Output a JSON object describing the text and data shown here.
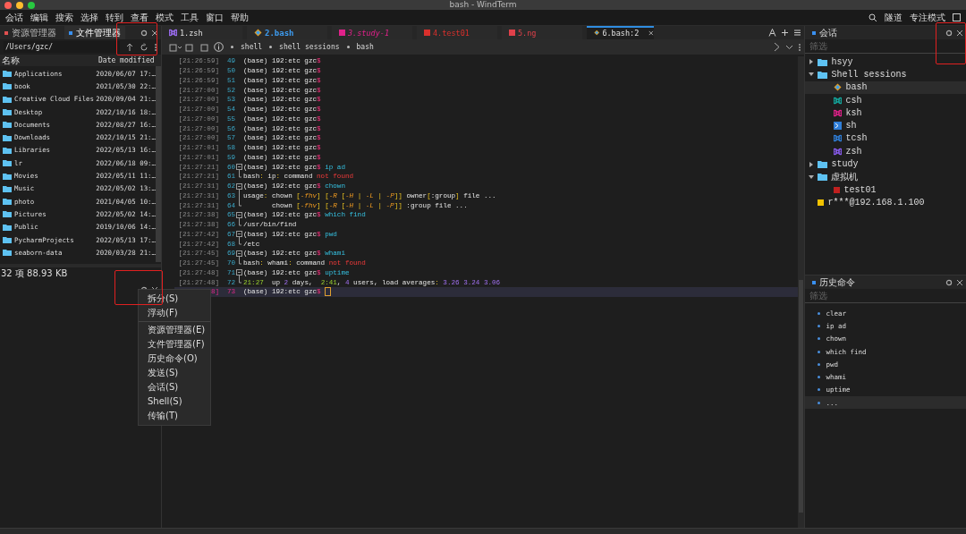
{
  "window": {
    "title": "bash - WindTerm"
  },
  "menu_bar": {
    "items": [
      "会话",
      "编辑",
      "搜索",
      "选择",
      "转到",
      "查看",
      "模式",
      "工具",
      "窗口",
      "帮助"
    ],
    "right": [
      "隧道",
      "专注模式"
    ]
  },
  "left_panel": {
    "tabs": [
      {
        "label": "资源管理器",
        "selected": false
      },
      {
        "label": "文件管理器",
        "selected": true
      }
    ],
    "path": "/Users/gzc/",
    "columns": [
      "名称",
      "Date modified"
    ],
    "files": [
      {
        "name": "Applications",
        "date": "2020/06/07 17:…"
      },
      {
        "name": "book",
        "date": "2021/05/30 22:…"
      },
      {
        "name": "Creative Cloud Files",
        "date": "2020/09/04 21:…"
      },
      {
        "name": "Desktop",
        "date": "2022/10/16 18:…"
      },
      {
        "name": "Documents",
        "date": "2022/08/27 16:…"
      },
      {
        "name": "Downloads",
        "date": "2022/10/15 21:…"
      },
      {
        "name": "Libraries",
        "date": "2022/05/13 16:…"
      },
      {
        "name": "lr",
        "date": "2022/06/18 09:…"
      },
      {
        "name": "Movies",
        "date": "2022/05/11 11:…"
      },
      {
        "name": "Music",
        "date": "2022/05/02 13:…"
      },
      {
        "name": "photo",
        "date": "2021/04/05 10:…"
      },
      {
        "name": "Pictures",
        "date": "2022/05/02 14:…"
      },
      {
        "name": "Public",
        "date": "2019/10/06 14:…"
      },
      {
        "name": "PycharmProjects",
        "date": "2022/05/13 17:…"
      },
      {
        "name": "seaborn-data",
        "date": "2020/03/28 21:…"
      }
    ],
    "status": "32 项 88.93 KB"
  },
  "context_menu": {
    "groups": [
      [
        "拆分(S)",
        "浮动(F)"
      ],
      [
        "资源管理器(E)",
        "文件管理器(F)",
        "历史命令(O)",
        "发送(S)",
        "会话(S)",
        "Shell(S)",
        "传输(T)"
      ]
    ]
  },
  "terminal_tabs": [
    {
      "label": "1.zsh",
      "kind": "shell",
      "color": "#9b6cf0",
      "selected": false
    },
    {
      "label": "2.bash",
      "kind": "bash",
      "color": "#3d9cf0",
      "selected": false
    },
    {
      "label": "3.study-1",
      "kind": "session",
      "color": "#e0218a",
      "selected": false
    },
    {
      "label": "4.test01",
      "kind": "session",
      "color": "#d9302c",
      "selected": false
    },
    {
      "label": "5.ng",
      "kind": "session",
      "color": "#e0404a",
      "selected": false
    },
    {
      "label": "6.bash:2",
      "kind": "bash",
      "selected": true
    }
  ],
  "breadcrumb": [
    "shell",
    "shell sessions",
    "bash"
  ],
  "terminal_lines": [
    {
      "time": "[21:26:59]",
      "num": "49",
      "kind": "plain",
      "segs": [
        {
          "kind": "text",
          "t": "(base) 192:etc gzc"
        },
        {
          "kind": "sign",
          "t": "$"
        }
      ]
    },
    {
      "time": "[21:26:59]",
      "num": "50",
      "kind": "plain",
      "segs": [
        {
          "kind": "text",
          "t": "(base) 192:etc gzc"
        },
        {
          "kind": "sign",
          "t": "$"
        }
      ]
    },
    {
      "time": "[21:26:59]",
      "num": "51",
      "kind": "plain",
      "segs": [
        {
          "kind": "text",
          "t": "(base) 192:etc gzc"
        },
        {
          "kind": "sign",
          "t": "$"
        }
      ]
    },
    {
      "time": "[21:27:00]",
      "num": "52",
      "kind": "plain",
      "segs": [
        {
          "kind": "text",
          "t": "(base) 192:etc gzc"
        },
        {
          "kind": "sign",
          "t": "$"
        }
      ]
    },
    {
      "time": "[21:27:00]",
      "num": "53",
      "kind": "plain",
      "segs": [
        {
          "kind": "text",
          "t": "(base) 192:etc gzc"
        },
        {
          "kind": "sign",
          "t": "$"
        }
      ]
    },
    {
      "time": "[21:27:00]",
      "num": "54",
      "kind": "plain",
      "segs": [
        {
          "kind": "text",
          "t": "(base) 192:etc gzc"
        },
        {
          "kind": "sign",
          "t": "$"
        }
      ]
    },
    {
      "time": "[21:27:00]",
      "num": "55",
      "kind": "plain",
      "segs": [
        {
          "kind": "text",
          "t": "(base) 192:etc gzc"
        },
        {
          "kind": "sign",
          "t": "$"
        }
      ]
    },
    {
      "time": "[21:27:00]",
      "num": "56",
      "kind": "plain",
      "segs": [
        {
          "kind": "text",
          "t": "(base) 192:etc gzc"
        },
        {
          "kind": "sign",
          "t": "$"
        }
      ]
    },
    {
      "time": "[21:27:00]",
      "num": "57",
      "kind": "plain",
      "segs": [
        {
          "kind": "text",
          "t": "(base) 192:etc gzc"
        },
        {
          "kind": "sign",
          "t": "$"
        }
      ]
    },
    {
      "time": "[21:27:01]",
      "num": "58",
      "kind": "plain",
      "segs": [
        {
          "kind": "text",
          "t": "(base) 192:etc gzc"
        },
        {
          "kind": "sign",
          "t": "$"
        }
      ]
    },
    {
      "time": "[21:27:01]",
      "num": "59",
      "kind": "plain",
      "segs": [
        {
          "kind": "text",
          "t": "(base) 192:etc gzc"
        },
        {
          "kind": "sign",
          "t": "$"
        }
      ]
    },
    {
      "time": "[21:27:21]",
      "num": "60",
      "kind": "fold_start",
      "segs": [
        {
          "kind": "text",
          "t": "(base) 192:etc gzc"
        },
        {
          "kind": "sign",
          "t": "$"
        },
        {
          "kind": "command",
          "t": " ip ad"
        }
      ]
    },
    {
      "time": "[21:27:21]",
      "num": "61",
      "kind": "fold_end",
      "segs": [
        {
          "kind": "text",
          "t": "bash"
        },
        {
          "kind": "punct",
          "t": ":"
        },
        {
          "kind": "text",
          "t": " ip"
        },
        {
          "kind": "punct",
          "t": ":"
        },
        {
          "kind": "text",
          "t": " command "
        },
        {
          "kind": "error",
          "t": "not found"
        }
      ]
    },
    {
      "time": "[21:27:31]",
      "num": "62",
      "kind": "fold_start",
      "segs": [
        {
          "kind": "text",
          "t": "(base) 192:etc gzc"
        },
        {
          "kind": "sign",
          "t": "$"
        },
        {
          "kind": "command",
          "t": " chown"
        }
      ]
    },
    {
      "time": "[21:27:31]",
      "num": "63",
      "kind": "fold_middle",
      "segs": [
        {
          "kind": "text",
          "t": "usage"
        },
        {
          "kind": "punct",
          "t": ":"
        },
        {
          "kind": "text",
          "t": " chown "
        },
        {
          "kind": "punct",
          "t": "["
        },
        {
          "kind": "option",
          "t": "-fhv"
        },
        {
          "kind": "punct",
          "t": "] ["
        },
        {
          "kind": "option",
          "t": "-R"
        },
        {
          "kind": "punct",
          "t": " ["
        },
        {
          "kind": "option",
          "t": "-H"
        },
        {
          "kind": "punct",
          "t": " | "
        },
        {
          "kind": "option",
          "t": "-L"
        },
        {
          "kind": "punct",
          "t": " | "
        },
        {
          "kind": "option",
          "t": "-P"
        },
        {
          "kind": "punct",
          "t": "]]"
        },
        {
          "kind": "text",
          "t": " owner"
        },
        {
          "kind": "punct",
          "t": "["
        },
        {
          "kind": "text",
          "t": ":group"
        },
        {
          "kind": "punct",
          "t": "]"
        },
        {
          "kind": "text",
          "t": " file ..."
        }
      ]
    },
    {
      "time": "[21:27:31]",
      "num": "64",
      "kind": "fold_end",
      "segs": [
        {
          "kind": "text",
          "t": "       chown "
        },
        {
          "kind": "punct",
          "t": "["
        },
        {
          "kind": "option",
          "t": "-fhv"
        },
        {
          "kind": "punct",
          "t": "] ["
        },
        {
          "kind": "option",
          "t": "-R"
        },
        {
          "kind": "punct",
          "t": " ["
        },
        {
          "kind": "option",
          "t": "-H"
        },
        {
          "kind": "punct",
          "t": " | "
        },
        {
          "kind": "option",
          "t": "-L"
        },
        {
          "kind": "punct",
          "t": " | "
        },
        {
          "kind": "option",
          "t": "-P"
        },
        {
          "kind": "punct",
          "t": "]]"
        },
        {
          "kind": "text",
          "t": " :group file ..."
        }
      ]
    },
    {
      "time": "[21:27:38]",
      "num": "65",
      "kind": "fold_start",
      "segs": [
        {
          "kind": "text",
          "t": "(base) 192:etc gzc"
        },
        {
          "kind": "sign",
          "t": "$"
        },
        {
          "kind": "command",
          "t": " which find"
        }
      ]
    },
    {
      "time": "[21:27:38]",
      "num": "66",
      "kind": "fold_end",
      "segs": [
        {
          "kind": "text",
          "t": "/usr/bin/find"
        }
      ]
    },
    {
      "time": "[21:27:42]",
      "num": "67",
      "kind": "fold_start",
      "segs": [
        {
          "kind": "text",
          "t": "(base) 192:etc gzc"
        },
        {
          "kind": "sign",
          "t": "$"
        },
        {
          "kind": "command",
          "t": " pwd"
        }
      ]
    },
    {
      "time": "[21:27:42]",
      "num": "68",
      "kind": "fold_end",
      "segs": [
        {
          "kind": "text",
          "t": "/etc"
        }
      ]
    },
    {
      "time": "[21:27:45]",
      "num": "69",
      "kind": "fold_start",
      "segs": [
        {
          "kind": "text",
          "t": "(base) 192:etc gzc"
        },
        {
          "kind": "sign",
          "t": "$"
        },
        {
          "kind": "command",
          "t": " whami"
        }
      ]
    },
    {
      "time": "[21:27:45]",
      "num": "70",
      "kind": "fold_end",
      "segs": [
        {
          "kind": "text",
          "t": "bash"
        },
        {
          "kind": "punct",
          "t": ":"
        },
        {
          "kind": "text",
          "t": " whami"
        },
        {
          "kind": "punct",
          "t": ":"
        },
        {
          "kind": "text",
          "t": " command "
        },
        {
          "kind": "error",
          "t": "not found"
        }
      ]
    },
    {
      "time": "[21:27:48]",
      "num": "71",
      "kind": "fold_start",
      "segs": [
        {
          "kind": "text",
          "t": "(base) 192:etc gzc"
        },
        {
          "kind": "sign",
          "t": "$"
        },
        {
          "kind": "command",
          "t": " uptime"
        }
      ]
    },
    {
      "time": "[21:27:48]",
      "num": "72",
      "kind": "fold_end",
      "segs": [
        {
          "kind": "time",
          "t": "21:27"
        },
        {
          "kind": "text",
          "t": "  up "
        },
        {
          "kind": "number",
          "t": "2"
        },
        {
          "kind": "text",
          "t": " days,  "
        },
        {
          "kind": "time",
          "t": "2:41"
        },
        {
          "kind": "text",
          "t": ", "
        },
        {
          "kind": "number",
          "t": "4"
        },
        {
          "kind": "text",
          "t": " users, load averages"
        },
        {
          "kind": "punct",
          "t": ":"
        },
        {
          "kind": "number",
          "t": " 3.26 3.24 3.06"
        }
      ]
    },
    {
      "time": "8]",
      "num": "73",
      "kind": "plain",
      "current": true,
      "segs": [
        {
          "kind": "text",
          "t": "(base) 192:etc gzc"
        },
        {
          "kind": "sign",
          "t": "$"
        }
      ]
    }
  ],
  "sessions": {
    "title": "会话",
    "filter_placeholder": "筛选",
    "tree": [
      {
        "label": "hsyy",
        "kind": "folder",
        "expanded": false,
        "selected": false
      },
      {
        "label": "Shell sessions",
        "kind": "folder",
        "expanded": true,
        "selected": false,
        "children": [
          {
            "label": "bash",
            "kind": "bash",
            "selected": true
          },
          {
            "label": "csh",
            "kind": "shell",
            "color": "#13a89e",
            "selected": false
          },
          {
            "label": "ksh",
            "kind": "shell",
            "color": "#e0218a",
            "selected": false
          },
          {
            "label": "sh",
            "kind": "terminal",
            "color": "#2f7ed8",
            "selected": false
          },
          {
            "label": "tcsh",
            "kind": "shell",
            "color": "#2f7ed8",
            "selected": false
          },
          {
            "label": "zsh",
            "kind": "shell",
            "color": "#8a5cf0",
            "selected": false
          }
        ]
      },
      {
        "label": "study",
        "kind": "folder",
        "expanded": false,
        "selected": false
      },
      {
        "label": "虚拟机",
        "kind": "folder",
        "expanded": true,
        "selected": false,
        "children": [
          {
            "label": "test01",
            "kind": "session",
            "color": "#c0201f",
            "selected": false
          }
        ]
      },
      {
        "label": "r***@192.168.1.100",
        "kind": "session",
        "color": "#f2c200",
        "selected": false
      }
    ]
  },
  "history": {
    "title": "历史命令",
    "filter_placeholder": "筛选",
    "items": [
      {
        "label": "clear",
        "selected": false
      },
      {
        "label": "ip ad",
        "selected": false
      },
      {
        "label": "chown",
        "selected": false
      },
      {
        "label": "which find",
        "selected": false
      },
      {
        "label": "pwd",
        "selected": false
      },
      {
        "label": "whami",
        "selected": false
      },
      {
        "label": "uptime",
        "selected": false
      },
      {
        "label": "...",
        "selected": true
      }
    ]
  }
}
